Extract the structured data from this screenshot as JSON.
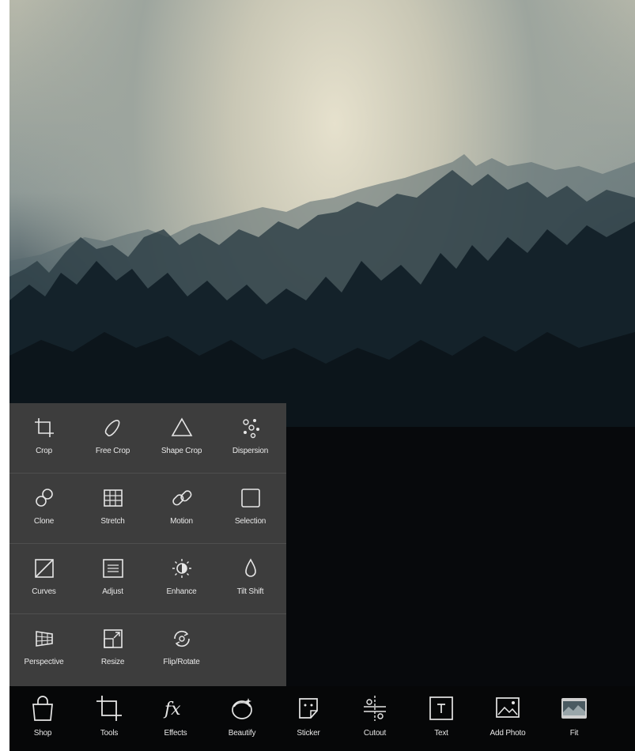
{
  "photo": {
    "description_icon": "forest-photo"
  },
  "tools_panel": {
    "rows": [
      {
        "items": [
          {
            "label": "Crop",
            "icon": "crop-icon"
          },
          {
            "label": "Free Crop",
            "icon": "free-crop-icon"
          },
          {
            "label": "Shape Crop",
            "icon": "shape-crop-icon"
          },
          {
            "label": "Dispersion",
            "icon": "dispersion-icon"
          }
        ]
      },
      {
        "items": [
          {
            "label": "Clone",
            "icon": "clone-icon"
          },
          {
            "label": "Stretch",
            "icon": "stretch-icon"
          },
          {
            "label": "Motion",
            "icon": "motion-icon"
          },
          {
            "label": "Selection",
            "icon": "selection-icon"
          }
        ]
      },
      {
        "items": [
          {
            "label": "Curves",
            "icon": "curves-icon"
          },
          {
            "label": "Adjust",
            "icon": "adjust-icon"
          },
          {
            "label": "Enhance",
            "icon": "enhance-icon"
          },
          {
            "label": "Tilt Shift",
            "icon": "tilt-shift-icon"
          }
        ]
      },
      {
        "items": [
          {
            "label": "Perspective",
            "icon": "perspective-icon"
          },
          {
            "label": "Resize",
            "icon": "resize-icon"
          },
          {
            "label": "Flip/Rotate",
            "icon": "flip-rotate-icon"
          }
        ]
      }
    ]
  },
  "bottom_bar": {
    "items": [
      {
        "label": "Shop",
        "icon": "shop-bag-icon"
      },
      {
        "label": "Tools",
        "icon": "crop-tools-icon"
      },
      {
        "label": "Effects",
        "icon": "fx-icon"
      },
      {
        "label": "Beautify",
        "icon": "beautify-icon"
      },
      {
        "label": "Sticker",
        "icon": "sticker-icon"
      },
      {
        "label": "Cutout",
        "icon": "cutout-icon"
      },
      {
        "label": "Text",
        "icon": "text-icon"
      },
      {
        "label": "Add Photo",
        "icon": "add-photo-icon"
      },
      {
        "label": "Fit",
        "icon": "fit-icon"
      }
    ]
  },
  "colors": {
    "panel_bg": "#3d3d3d",
    "bar_bg": "#060708",
    "icon_stroke": "#e6e6e6"
  }
}
